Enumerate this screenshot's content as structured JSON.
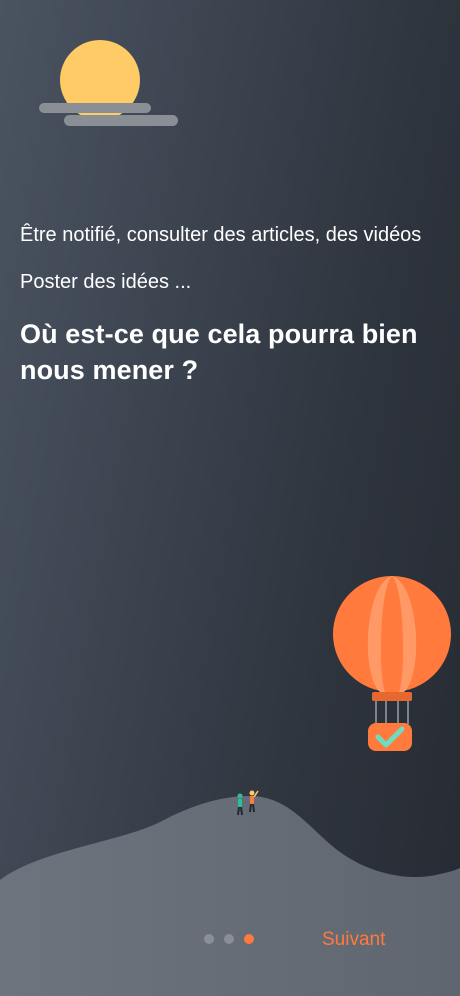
{
  "content": {
    "line1": "Être notifié, consulter des articles, des vidéos",
    "line2": "Poster des idées ...",
    "headline": "Où est-ce que cela pourra bien nous mener ?"
  },
  "pager": {
    "total": 3,
    "current": 3
  },
  "footer": {
    "next_label": "Suivant"
  },
  "icons": {
    "sun": "sun-icon",
    "cloud": "cloud-icon",
    "balloon": "hot-air-balloon-icon",
    "checkmark": "checkmark-icon",
    "hikers": "hikers-icon"
  },
  "colors": {
    "accent": "#ff7a3c",
    "sun": "#ffcb66",
    "background_dark": "#262b33",
    "hill": "#6d747e"
  }
}
